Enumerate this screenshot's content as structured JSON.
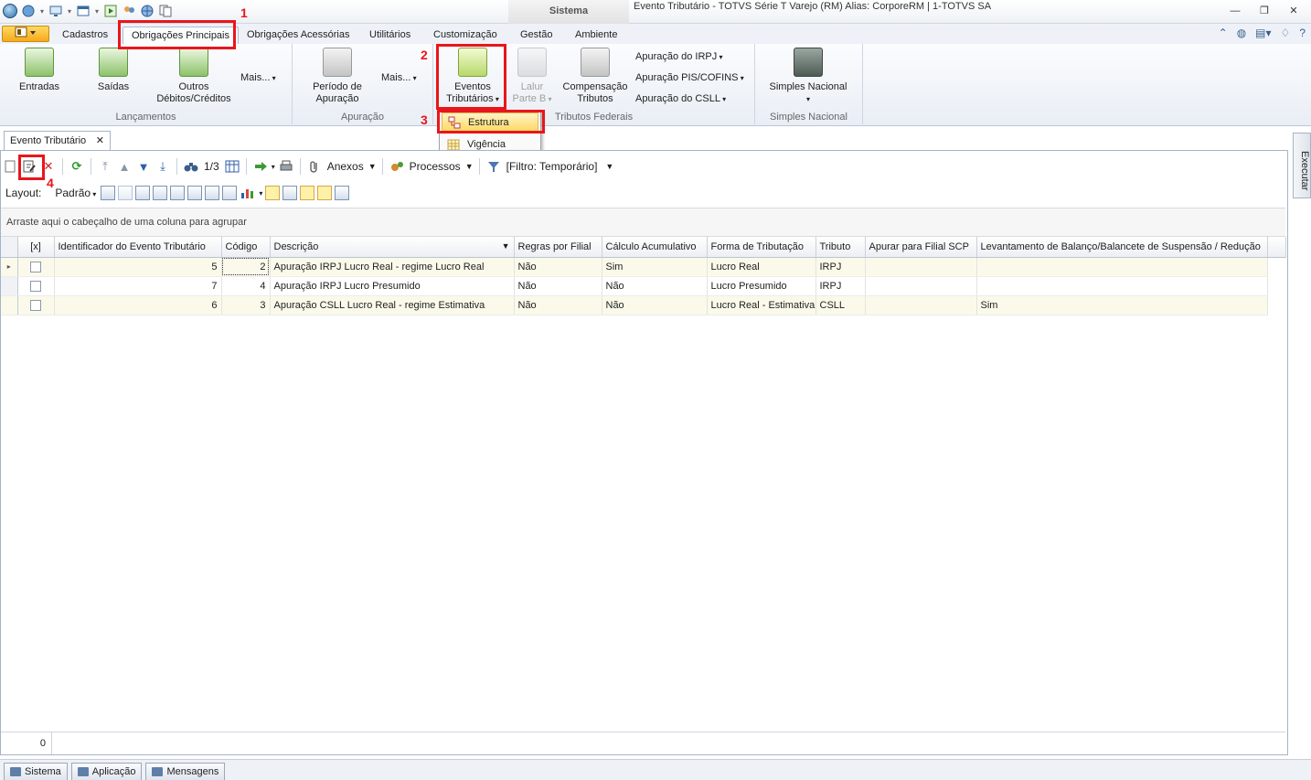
{
  "window": {
    "context_title": "Sistema",
    "title": "Evento Tributário - TOTVS Série T Varejo (RM) Alias: CorporeRM | 1-TOTVS SA",
    "minimize": "—",
    "restore": "❐",
    "close": "✕"
  },
  "ribbon_tabs": [
    "Cadastros",
    "Obrigações Principais",
    "Obrigações Acessórias",
    "Utilitários",
    "Customização",
    "Gestão",
    "Ambiente"
  ],
  "ribbon": {
    "lancamentos": {
      "label": "Lançamentos",
      "entradas": "Entradas",
      "saidas": "Saídas",
      "outros_line1": "Outros",
      "outros_line2": "Débitos/Créditos",
      "mais": "Mais..."
    },
    "apuracao": {
      "label": "Apuração",
      "periodo_line1": "Período de",
      "periodo_line2": "Apuração",
      "mais": "Mais..."
    },
    "tributos_federais": {
      "label": "Tributos Federais",
      "eventos_line1": "Eventos",
      "eventos_line2": "Tributários",
      "lalur_line1": "Lalur",
      "lalur_line2": "Parte B",
      "comp_line1": "Compensação",
      "comp_line2": "Tributos",
      "irpj": "Apuração do IRPJ",
      "pis": "Apuração PIS/COFINS",
      "csll": "Apuração do CSLL"
    },
    "simples": {
      "label": "Simples Nacional",
      "button": "Simples Nacional"
    }
  },
  "dropdown_menu": [
    "Estrutura",
    "Vigência"
  ],
  "annotations": [
    "1",
    "2",
    "3",
    "4"
  ],
  "doc_tab": {
    "title": "Evento Tributário",
    "close": "✕"
  },
  "side_panel": {
    "label": "Executar"
  },
  "toolbar": {
    "record_position": "1/3",
    "anexos": "Anexos",
    "processos": "Processos",
    "filtro": "[Filtro: Temporário]"
  },
  "layout_bar": {
    "label": "Layout:",
    "preset": "Padrão"
  },
  "group_hint": "Arraste aqui o cabeçalho de uma coluna para agrupar",
  "grid": {
    "select_all": "[x]",
    "columns": [
      "Identificador do Evento Tributário",
      "Código",
      "Descrição",
      "Regras por Filial",
      "Cálculo Acumulativo",
      "Forma de Tributação",
      "Tributo",
      "Apurar para Filial SCP",
      "Levantamento de Balanço/Balancete de Suspensão / Redução"
    ],
    "rows": [
      [
        "5",
        "2",
        "Apuração IRPJ Lucro Real - regime Lucro Real",
        "Não",
        "Sim",
        "Lucro Real",
        "IRPJ",
        "",
        ""
      ],
      [
        "7",
        "4",
        "Apuração IRPJ Lucro Presumido",
        "Não",
        "Não",
        "Lucro Presumido",
        "IRPJ",
        "",
        ""
      ],
      [
        "6",
        "3",
        "Apuração CSLL Lucro Real - regime Estimativa",
        "Não",
        "Não",
        "Lucro Real - Estimativa",
        "CSLL",
        "",
        "Sim"
      ]
    ],
    "footer_count": "0"
  },
  "status_buttons": [
    "Sistema",
    "Aplicação",
    "Mensagens"
  ],
  "colors": {
    "highlight": "#e8161b",
    "menu_hot": "#ffd861",
    "file_button": "#f7a91a"
  }
}
